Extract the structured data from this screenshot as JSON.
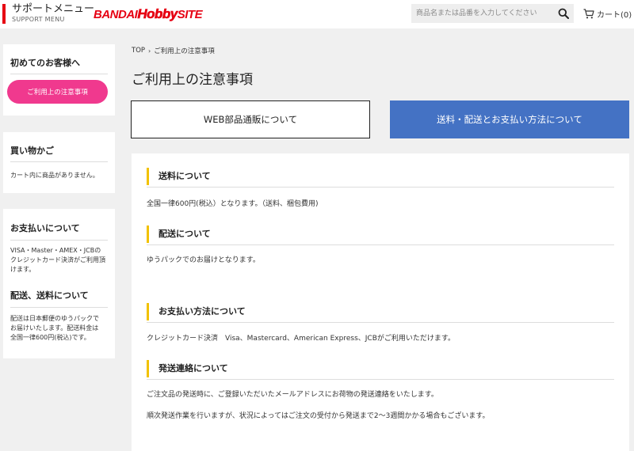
{
  "header": {
    "support_title": "サポートメニュー",
    "support_sub": "SUPPORT MENU",
    "logo_part1": "BANDAI",
    "logo_part2": "Hobby",
    "logo_part3": "SITE",
    "search_placeholder": "商品名または品番を入力してください",
    "cart_label": "カート(0)"
  },
  "sidebar": {
    "first_time": {
      "heading": "初めてのお客様へ",
      "button_label": "ご利用上の注意事項"
    },
    "cart": {
      "heading": "買い物かご",
      "empty_text": "カート内に商品がありません。"
    },
    "payment": {
      "heading": "お支払いについて",
      "text_lines": [
        "VISA・Master・AMEX・JCBの",
        "クレジットカード決済がご利用頂",
        "けます。"
      ]
    },
    "delivery": {
      "heading": "配送、送料について",
      "text_lines": [
        "配送は日本郵便のゆうパックで",
        "お届けいたします。配送料金は",
        "全国一律600円(税込)です。"
      ]
    }
  },
  "breadcrumb": {
    "top": "TOP",
    "separator": "›",
    "current": "ご利用上の注意事項"
  },
  "page_title": "ご利用上の注意事項",
  "tabs": [
    {
      "label": "WEB部品通販について"
    },
    {
      "label": "送料・配送とお支払い方法について"
    }
  ],
  "sections": [
    {
      "title": "送料について",
      "lines": [
        "全国一律600円(税込）となります。（送料、梱包費用)"
      ]
    },
    {
      "title": "配送について",
      "lines": [
        "ゆうパックでのお届けとなります。"
      ]
    },
    {
      "title": "お支払い方法について",
      "lines": [
        "クレジットカード決済　Visa、Mastercard、American Express、JCBがご利用いただけます。"
      ]
    },
    {
      "title": "発送連絡について",
      "lines": [
        "ご注文品の発送時に、ご登録いただいたメールアドレスにお荷物の発送連絡をいたします。",
        "順次発送作業を行いますが、状況によってはご注文の受付から発送まで2〜3週間かかる場合もございます。"
      ]
    }
  ],
  "colors": {
    "brand_red": "#e60012",
    "pink_button": "#f0398e",
    "active_tab_blue": "#4472c4",
    "section_accent": "#f2c200"
  }
}
